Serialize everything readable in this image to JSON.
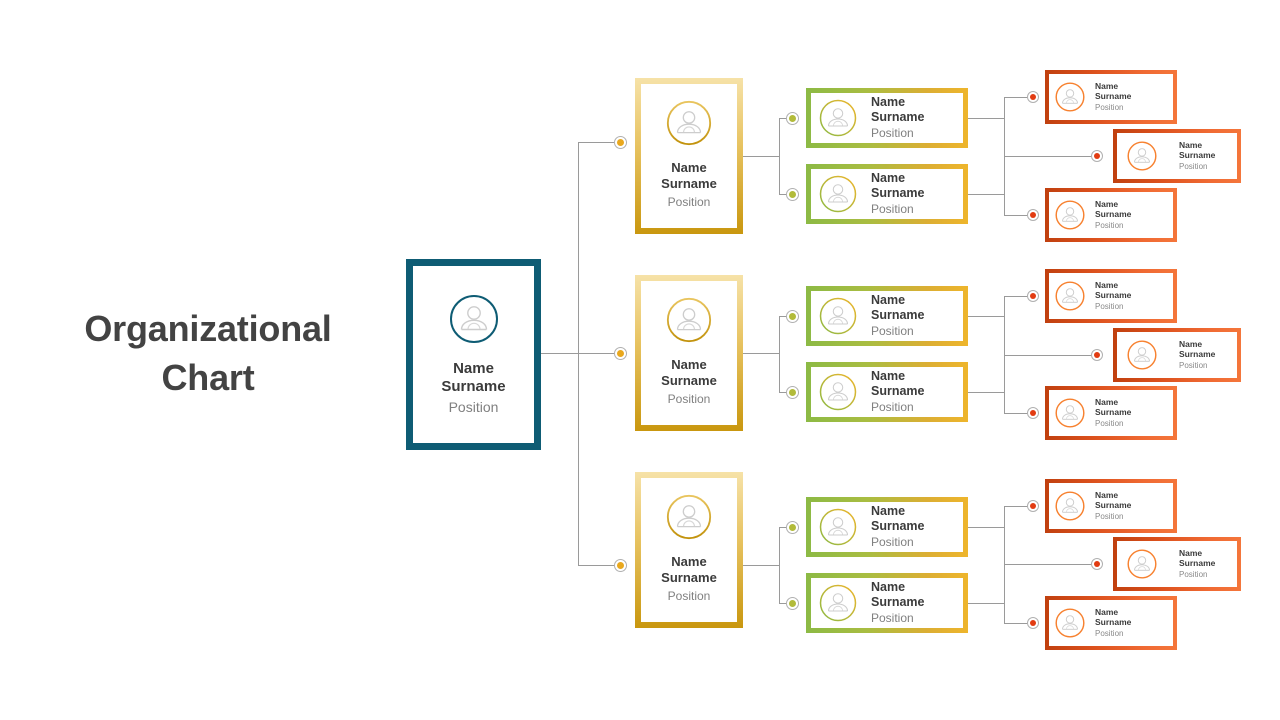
{
  "title": {
    "line1": "Organizational",
    "line2": "Chart"
  },
  "labels": {
    "name": "Name",
    "surname": "Surname",
    "position": "Position"
  },
  "colors": {
    "root_border": "#0e5c74",
    "level2_gold_light": "#f6e2a8",
    "level2_gold_dark": "#c9970f",
    "level3_green": "#8cba45",
    "level3_gold": "#eeb52c",
    "leaf_red": "#c0400f",
    "leaf_orange": "#f4763b",
    "title_text": "#434343",
    "name_text": "#3b3b3b",
    "position_text": "#808080",
    "connector_line": "#9a9a9a"
  },
  "icons": {
    "avatar": "user-avatar-icon",
    "connector": "connector-dot-icon"
  },
  "root": {
    "name": "Name",
    "surname": "Surname",
    "position": "Position"
  },
  "branches": [
    {
      "id": "branch-1",
      "manager": {
        "name": "Name",
        "surname": "Surname",
        "position": "Position"
      },
      "leads": [
        {
          "name": "Name",
          "surname": "Surname",
          "position": "Position"
        },
        {
          "name": "Name",
          "surname": "Surname",
          "position": "Position"
        }
      ],
      "members": [
        {
          "name": "Name",
          "surname": "Surname",
          "position": "Position"
        },
        {
          "name": "Name",
          "surname": "Surname",
          "position": "Position"
        },
        {
          "name": "Name",
          "surname": "Surname",
          "position": "Position"
        }
      ]
    },
    {
      "id": "branch-2",
      "manager": {
        "name": "Name",
        "surname": "Surname",
        "position": "Position"
      },
      "leads": [
        {
          "name": "Name",
          "surname": "Surname",
          "position": "Position"
        },
        {
          "name": "Name",
          "surname": "Surname",
          "position": "Position"
        }
      ],
      "members": [
        {
          "name": "Name",
          "surname": "Surname",
          "position": "Position"
        },
        {
          "name": "Name",
          "surname": "Surname",
          "position": "Position"
        },
        {
          "name": "Name",
          "surname": "Surname",
          "position": "Position"
        }
      ]
    },
    {
      "id": "branch-3",
      "manager": {
        "name": "Name",
        "surname": "Surname",
        "position": "Position"
      },
      "leads": [
        {
          "name": "Name",
          "surname": "Surname",
          "position": "Position"
        },
        {
          "name": "Name",
          "surname": "Surname",
          "position": "Position"
        }
      ],
      "members": [
        {
          "name": "Name",
          "surname": "Surname",
          "position": "Position"
        },
        {
          "name": "Name",
          "surname": "Surname",
          "position": "Position"
        },
        {
          "name": "Name",
          "surname": "Surname",
          "position": "Position"
        }
      ]
    }
  ]
}
